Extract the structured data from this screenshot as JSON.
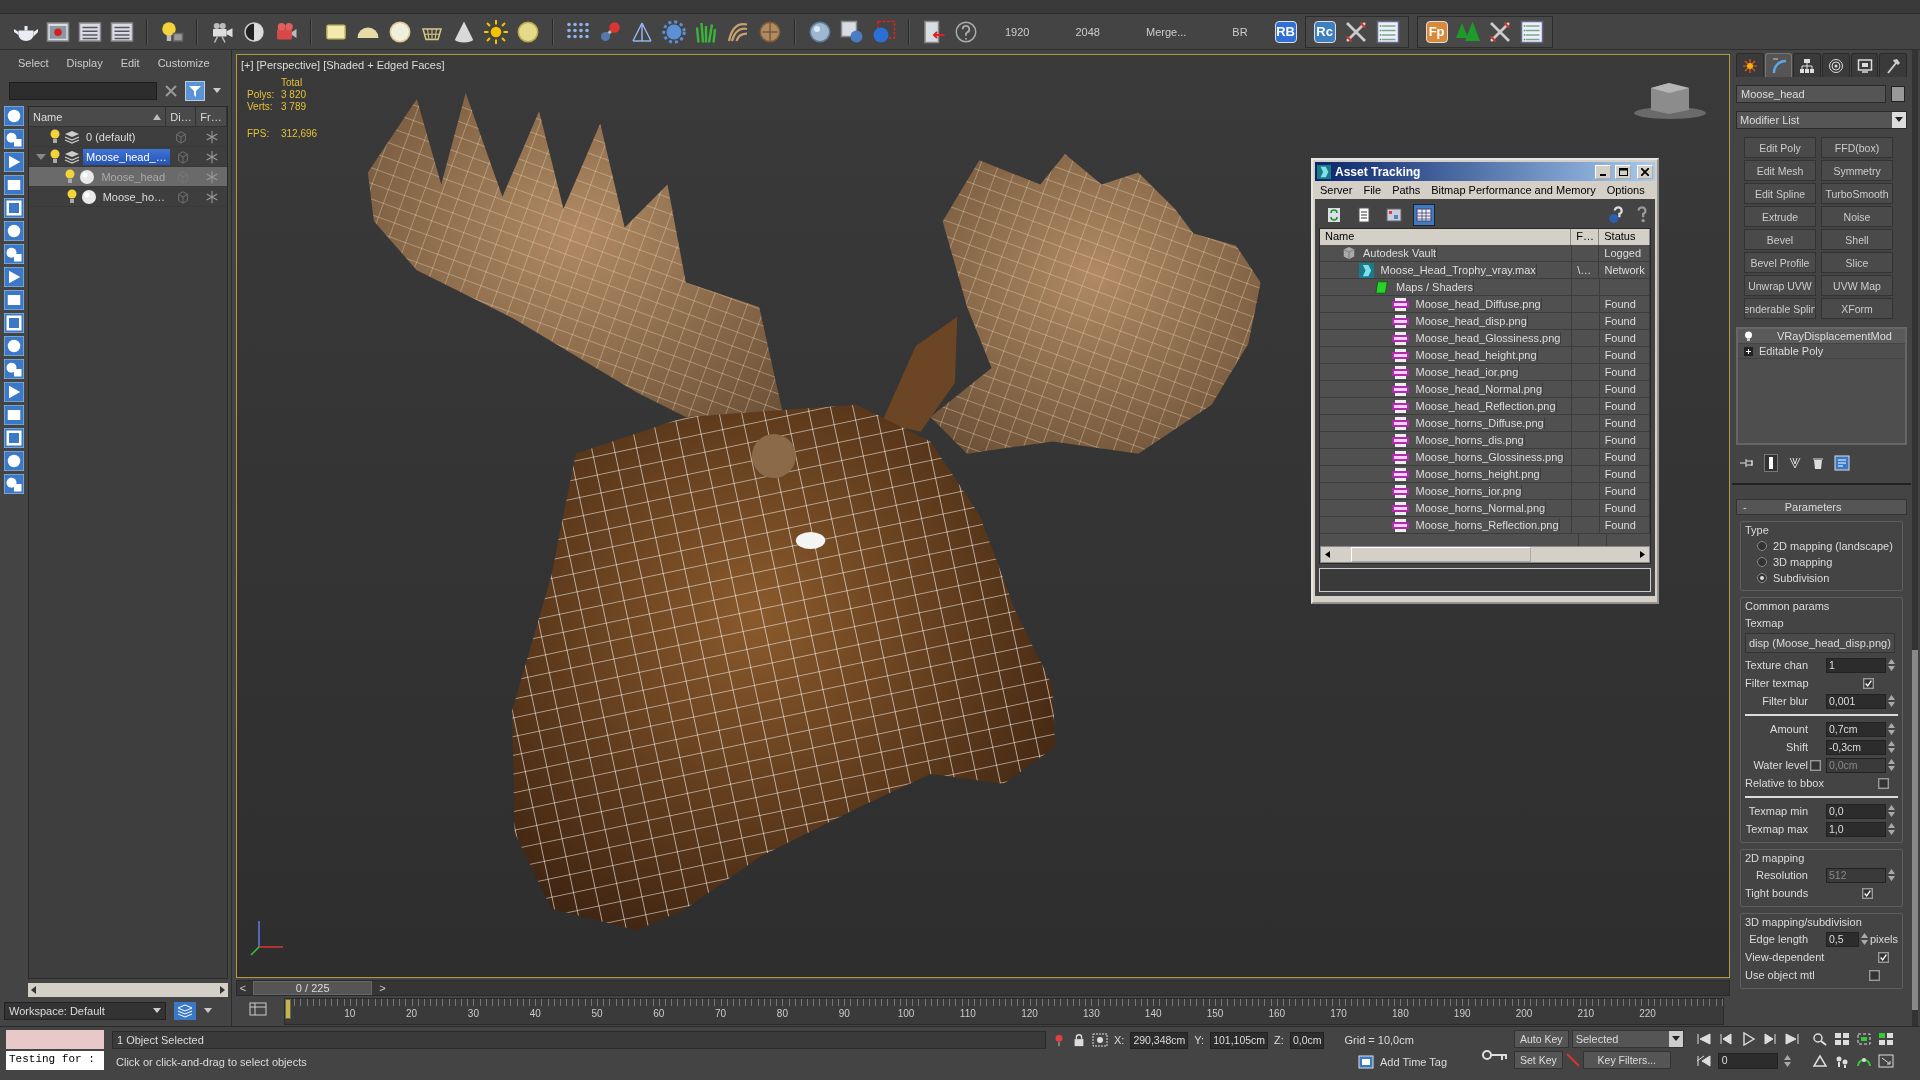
{
  "toolbar": {
    "labels": [
      "1920",
      "2048",
      "Merge...",
      "BR"
    ],
    "badges": [
      {
        "text": "RB",
        "color": "#2f6fd6"
      },
      {
        "text": "Rc",
        "color": "#3d7fc0"
      },
      {
        "text": "Fp",
        "color": "#d9893a"
      }
    ]
  },
  "scene_explorer": {
    "menu": [
      "Select",
      "Display",
      "Edit",
      "Customize"
    ],
    "columns": [
      "Name",
      "Di…",
      "Fr…"
    ],
    "tree": [
      {
        "label": "0 (default)",
        "kind": "layer",
        "selected": false
      },
      {
        "label": "Moose_head_…",
        "kind": "layer",
        "selected": true,
        "expanded": true,
        "children": [
          {
            "label": "Moose_head",
            "kind": "object",
            "selected": true
          },
          {
            "label": "Moose_ho…",
            "kind": "object",
            "selected": false
          }
        ]
      }
    ],
    "workspace": "Workspace: Default"
  },
  "viewport": {
    "labels": [
      "[+]",
      "[Perspective]",
      "[Shaded + Edged Faces]"
    ],
    "stats_heading": "Total",
    "stats": [
      {
        "label": "Polys:",
        "value": "3 820"
      },
      {
        "label": "Verts:",
        "value": "3 789"
      }
    ],
    "fps": {
      "label": "FPS:",
      "value": "312,696"
    }
  },
  "asset_tracking": {
    "title": "Asset Tracking",
    "menu": [
      "Server",
      "File",
      "Paths",
      "Bitmap Performance and Memory",
      "Options"
    ],
    "view_buttons": [
      {
        "selected": false
      },
      {
        "selected": false
      },
      {
        "selected": false
      },
      {
        "selected": true
      }
    ],
    "columns": [
      "Name",
      "F…",
      "Status"
    ],
    "tree": [
      {
        "name": "Autodesk Vault",
        "kind": "vault",
        "status": "Logged",
        "children": [
          {
            "name": "Moose_Head_Trophy_vray.max",
            "kind": "scene",
            "path": "\\…",
            "status": "Network",
            "children": [
              {
                "name": "Maps / Shaders",
                "kind": "folder",
                "children": [
                  {
                    "name": "Moose_head_Diffuse.png",
                    "kind": "png",
                    "status": "Found"
                  },
                  {
                    "name": "Moose_head_disp.png",
                    "kind": "png",
                    "status": "Found"
                  },
                  {
                    "name": "Moose_head_Glossiness.png",
                    "kind": "png",
                    "status": "Found"
                  },
                  {
                    "name": "Moose_head_height.png",
                    "kind": "png",
                    "status": "Found"
                  },
                  {
                    "name": "Moose_head_ior.png",
                    "kind": "png",
                    "status": "Found"
                  },
                  {
                    "name": "Moose_head_Normal.png",
                    "kind": "png",
                    "status": "Found"
                  },
                  {
                    "name": "Moose_head_Reflection.png",
                    "kind": "png",
                    "status": "Found"
                  },
                  {
                    "name": "Moose_horns_Diffuse.png",
                    "kind": "png",
                    "status": "Found"
                  },
                  {
                    "name": "Moose_horns_dis.png",
                    "kind": "png",
                    "status": "Found"
                  },
                  {
                    "name": "Moose_horns_Glossiness.png",
                    "kind": "png",
                    "status": "Found"
                  },
                  {
                    "name": "Moose_horns_height.png",
                    "kind": "png",
                    "status": "Found"
                  },
                  {
                    "name": "Moose_horns_ior.png",
                    "kind": "png",
                    "status": "Found"
                  },
                  {
                    "name": "Moose_horns_Normal.png",
                    "kind": "png",
                    "status": "Found"
                  },
                  {
                    "name": "Moose_horns_Reflection.png",
                    "kind": "png",
                    "status": "Found"
                  }
                ]
              }
            ]
          }
        ]
      }
    ]
  },
  "command_panel": {
    "tabs": [
      {
        "selected": false
      },
      {
        "selected": true
      },
      {
        "selected": false
      },
      {
        "selected": false
      },
      {
        "selected": false
      },
      {
        "selected": false
      }
    ],
    "object_name": "Moose_head",
    "modifier_list": "Modifier List",
    "modifier_buttons": [
      "Edit Poly",
      "FFD(box)",
      "Edit Mesh",
      "Symmetry",
      "Edit Spline",
      "TurboSmooth",
      "Extrude",
      "Noise",
      "Bevel",
      "Shell",
      "Bevel Profile",
      "Slice",
      "Unwrap UVW",
      "UVW Map",
      "enderable Splin",
      "XForm"
    ],
    "stack": [
      {
        "label": "VRayDisplacementMod",
        "kind": "modifier"
      },
      {
        "label": "Editable Poly",
        "kind": "base"
      }
    ],
    "parameters": {
      "collapse_sign": "-",
      "title": "Parameters",
      "groups": [
        {
          "title": "Type",
          "rows": [
            {
              "kind": "radio",
              "label": "2D mapping (landscape)",
              "selected": false
            },
            {
              "kind": "radio",
              "label": "3D mapping",
              "selected": false
            },
            {
              "kind": "radio",
              "label": "Subdivision",
              "selected": true
            }
          ]
        },
        {
          "title": "Common params",
          "rows": [
            {
              "kind": "caption",
              "label": "Texmap"
            },
            {
              "kind": "map_button",
              "label": "disp (Moose_head_disp.png)"
            },
            {
              "kind": "spinner",
              "label": "Texture chan",
              "value": "1",
              "disabled": false
            },
            {
              "kind": "checkbox",
              "label": "Filter texmap",
              "checked": true
            },
            {
              "kind": "spinner",
              "label": "Filter blur",
              "value": "0,001",
              "disabled": false
            },
            {
              "kind": "rule"
            },
            {
              "kind": "spinner",
              "label": "Amount",
              "value": "0,7cm",
              "disabled": false
            },
            {
              "kind": "spinner",
              "label": "Shift",
              "value": "-0,3cm",
              "disabled": false
            },
            {
              "kind": "check_spinner",
              "label": "Water level",
              "checked": false,
              "value": "0,0cm",
              "disabled": true
            },
            {
              "kind": "checkbox",
              "label": "Relative to bbox",
              "checked": false
            },
            {
              "kind": "rule"
            },
            {
              "kind": "spinner",
              "label": "Texmap min",
              "value": "0,0",
              "disabled": false
            },
            {
              "kind": "spinner",
              "label": "Texmap max",
              "value": "1,0",
              "disabled": false
            }
          ]
        },
        {
          "title": "2D mapping",
          "rows": [
            {
              "kind": "spinner",
              "label": "Resolution",
              "value": "512",
              "disabled": true
            },
            {
              "kind": "checkbox",
              "label": "Tight bounds",
              "checked": true
            }
          ]
        },
        {
          "title": "3D mapping/subdivision",
          "rows": [
            {
              "kind": "spinner",
              "label": "Edge length",
              "value": "0,5",
              "unit": "pixels",
              "disabled": false
            },
            {
              "kind": "checkbox",
              "label": "View-dependent",
              "checked": true
            },
            {
              "kind": "checkbox",
              "label": "Use object mtl",
              "checked": false
            }
          ]
        }
      ]
    }
  },
  "time_slider": {
    "prev": "<",
    "position": "0 / 225",
    "next": ">",
    "level": 0
  },
  "track_bar": {
    "ticks": [
      "10",
      "20",
      "30",
      "40",
      "50",
      "60",
      "70",
      "80",
      "90",
      "100",
      "110",
      "120",
      "130",
      "140",
      "150",
      "160",
      "170",
      "180",
      "190",
      "200",
      "210",
      "220"
    ]
  },
  "status_bar": {
    "listener": "Testing for :",
    "selection": "1 Object Selected",
    "prompt": "Click or click-and-drag to select objects",
    "coords": [
      {
        "label": "X:",
        "value": "290,348cm"
      },
      {
        "label": "Y:",
        "value": "101,105cm"
      },
      {
        "label": "Z:",
        "value": "0,0cm"
      }
    ],
    "grid": "Grid = 10,0cm",
    "time_tag": "Add Time Tag",
    "auto_key": "Auto Key",
    "key_mode": "Selected",
    "set_key": "Set Key",
    "key_filters": "Key Filters...",
    "frame": "0"
  }
}
